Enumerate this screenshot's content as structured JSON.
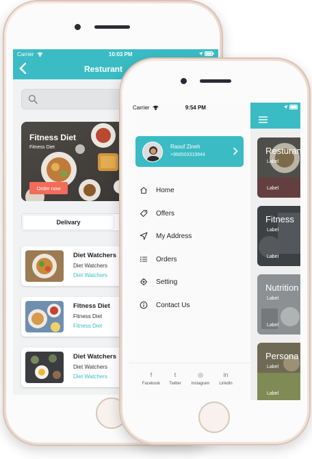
{
  "colors": {
    "accent": "#3bbcc4",
    "order_button": "#f26c5a"
  },
  "back_screen": {
    "status": {
      "carrier": "Carrier",
      "time": "10:03 PM"
    },
    "nav": {
      "title": "Resturant",
      "back_icon": "chevron-left-icon"
    },
    "search": {
      "icon": "search-icon"
    },
    "banner": {
      "title": "Fitness Diet",
      "subtitle": "Fitness Diet",
      "order_label": "Order now"
    },
    "segment": {
      "active_label": "Delivary"
    },
    "cards": [
      {
        "title": "Diet Watchers",
        "subtitle": "Diet Watchers",
        "link": "Diet Watchers"
      },
      {
        "title": "Fitness Diet",
        "subtitle": "Fitness Diet",
        "link": "Fitness Diet"
      },
      {
        "title": "Diet Watchers",
        "subtitle": "Diet Watchers",
        "link": "Diet Watchers"
      }
    ]
  },
  "front_screen": {
    "status": {
      "carrier": "Carrier",
      "time": "9:54 PM"
    },
    "profile": {
      "name": "Raouf Zineh",
      "phone": "+966503319944"
    },
    "menu": [
      {
        "label": "Home",
        "icon": "home-icon"
      },
      {
        "label": "Offers",
        "icon": "tag-icon"
      },
      {
        "label": "My Address",
        "icon": "location-arrow-icon"
      },
      {
        "label": "Orders",
        "icon": "list-icon"
      },
      {
        "label": "Setting",
        "icon": "gear-icon"
      },
      {
        "label": "Contact Us",
        "icon": "info-icon"
      }
    ],
    "social": [
      {
        "label": "Facebook",
        "glyph": "f"
      },
      {
        "label": "Twitter",
        "glyph": "t"
      },
      {
        "label": "Instagram",
        "glyph": "◎"
      },
      {
        "label": "LinkdIn",
        "glyph": "in"
      }
    ],
    "tiles": [
      {
        "title": "Resturant",
        "label1": "Label",
        "label2": "Label"
      },
      {
        "title": "Fitness",
        "label1": "Label",
        "label2": "Label"
      },
      {
        "title": "Nutrition",
        "label1": "Label",
        "label2": "Label"
      },
      {
        "title": "Persona",
        "label1": "Label",
        "label2": "Label"
      }
    ]
  }
}
